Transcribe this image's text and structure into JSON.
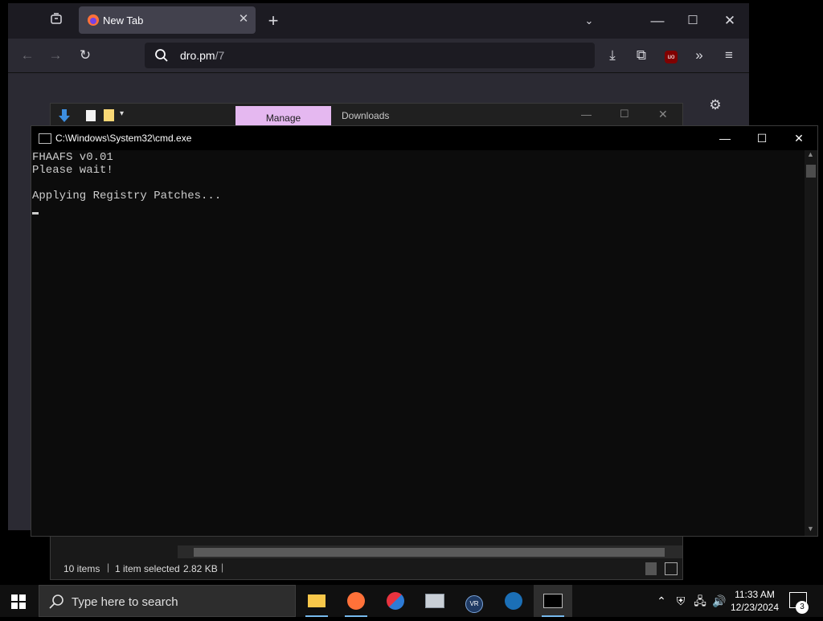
{
  "firefox": {
    "tab_title": "New Tab",
    "url_host": "dro.pm",
    "url_path": "/7",
    "icons": [
      "firefox-view-icon",
      "firefox-logo-icon",
      "close-icon",
      "plus-icon",
      "chevron-down-icon",
      "back-icon",
      "forward-icon",
      "reload-icon",
      "search-icon",
      "download-icon",
      "extensions-icon",
      "ublock-icon",
      "overflow-icon",
      "menu-icon",
      "gear-icon"
    ]
  },
  "explorer": {
    "tab_manage": "Manage",
    "tab_downloads": "Downloads",
    "status_items": "10 items",
    "status_selected": "1 item selected",
    "status_size": "2.82 KB"
  },
  "cmd": {
    "title": "C:\\Windows\\System32\\cmd.exe",
    "lines": [
      "FHAAFS v0.01",
      "Please wait!",
      "",
      "Applying Registry Patches..."
    ]
  },
  "taskbar": {
    "search_placeholder": "Type here to search",
    "time": "11:33 AM",
    "date": "12/23/2024",
    "notification_count": "3",
    "apps": [
      "file-explorer-icon",
      "firefox-icon",
      "app-swirl-icon",
      "app-monitor-icon",
      "vr-icon",
      "steam-icon",
      "cmd-icon"
    ]
  },
  "colors": {
    "manage_tab": "#e5b8f0",
    "cmd_bg": "#0c0c0c",
    "taskbar_bg": "#101010"
  }
}
